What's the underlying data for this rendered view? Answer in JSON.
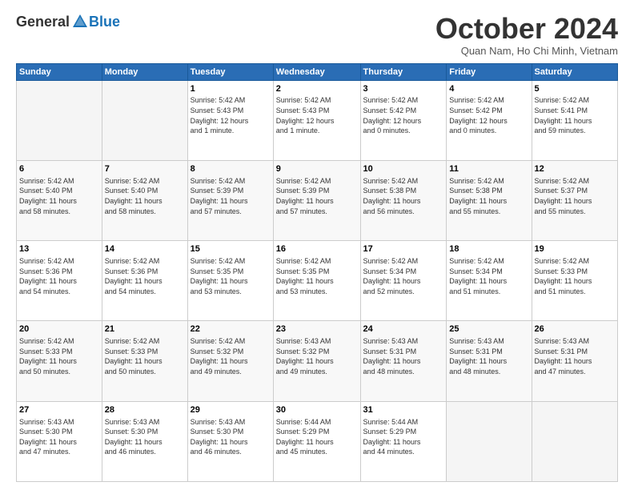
{
  "logo": {
    "general": "General",
    "blue": "Blue"
  },
  "header": {
    "title": "October 2024",
    "subtitle": "Quan Nam, Ho Chi Minh, Vietnam"
  },
  "days_of_week": [
    "Sunday",
    "Monday",
    "Tuesday",
    "Wednesday",
    "Thursday",
    "Friday",
    "Saturday"
  ],
  "weeks": [
    [
      {
        "day": "",
        "details": ""
      },
      {
        "day": "",
        "details": ""
      },
      {
        "day": "1",
        "details": "Sunrise: 5:42 AM\nSunset: 5:43 PM\nDaylight: 12 hours\nand 1 minute."
      },
      {
        "day": "2",
        "details": "Sunrise: 5:42 AM\nSunset: 5:43 PM\nDaylight: 12 hours\nand 1 minute."
      },
      {
        "day": "3",
        "details": "Sunrise: 5:42 AM\nSunset: 5:42 PM\nDaylight: 12 hours\nand 0 minutes."
      },
      {
        "day": "4",
        "details": "Sunrise: 5:42 AM\nSunset: 5:42 PM\nDaylight: 12 hours\nand 0 minutes."
      },
      {
        "day": "5",
        "details": "Sunrise: 5:42 AM\nSunset: 5:41 PM\nDaylight: 11 hours\nand 59 minutes."
      }
    ],
    [
      {
        "day": "6",
        "details": "Sunrise: 5:42 AM\nSunset: 5:40 PM\nDaylight: 11 hours\nand 58 minutes."
      },
      {
        "day": "7",
        "details": "Sunrise: 5:42 AM\nSunset: 5:40 PM\nDaylight: 11 hours\nand 58 minutes."
      },
      {
        "day": "8",
        "details": "Sunrise: 5:42 AM\nSunset: 5:39 PM\nDaylight: 11 hours\nand 57 minutes."
      },
      {
        "day": "9",
        "details": "Sunrise: 5:42 AM\nSunset: 5:39 PM\nDaylight: 11 hours\nand 57 minutes."
      },
      {
        "day": "10",
        "details": "Sunrise: 5:42 AM\nSunset: 5:38 PM\nDaylight: 11 hours\nand 56 minutes."
      },
      {
        "day": "11",
        "details": "Sunrise: 5:42 AM\nSunset: 5:38 PM\nDaylight: 11 hours\nand 55 minutes."
      },
      {
        "day": "12",
        "details": "Sunrise: 5:42 AM\nSunset: 5:37 PM\nDaylight: 11 hours\nand 55 minutes."
      }
    ],
    [
      {
        "day": "13",
        "details": "Sunrise: 5:42 AM\nSunset: 5:36 PM\nDaylight: 11 hours\nand 54 minutes."
      },
      {
        "day": "14",
        "details": "Sunrise: 5:42 AM\nSunset: 5:36 PM\nDaylight: 11 hours\nand 54 minutes."
      },
      {
        "day": "15",
        "details": "Sunrise: 5:42 AM\nSunset: 5:35 PM\nDaylight: 11 hours\nand 53 minutes."
      },
      {
        "day": "16",
        "details": "Sunrise: 5:42 AM\nSunset: 5:35 PM\nDaylight: 11 hours\nand 53 minutes."
      },
      {
        "day": "17",
        "details": "Sunrise: 5:42 AM\nSunset: 5:34 PM\nDaylight: 11 hours\nand 52 minutes."
      },
      {
        "day": "18",
        "details": "Sunrise: 5:42 AM\nSunset: 5:34 PM\nDaylight: 11 hours\nand 51 minutes."
      },
      {
        "day": "19",
        "details": "Sunrise: 5:42 AM\nSunset: 5:33 PM\nDaylight: 11 hours\nand 51 minutes."
      }
    ],
    [
      {
        "day": "20",
        "details": "Sunrise: 5:42 AM\nSunset: 5:33 PM\nDaylight: 11 hours\nand 50 minutes."
      },
      {
        "day": "21",
        "details": "Sunrise: 5:42 AM\nSunset: 5:33 PM\nDaylight: 11 hours\nand 50 minutes."
      },
      {
        "day": "22",
        "details": "Sunrise: 5:42 AM\nSunset: 5:32 PM\nDaylight: 11 hours\nand 49 minutes."
      },
      {
        "day": "23",
        "details": "Sunrise: 5:43 AM\nSunset: 5:32 PM\nDaylight: 11 hours\nand 49 minutes."
      },
      {
        "day": "24",
        "details": "Sunrise: 5:43 AM\nSunset: 5:31 PM\nDaylight: 11 hours\nand 48 minutes."
      },
      {
        "day": "25",
        "details": "Sunrise: 5:43 AM\nSunset: 5:31 PM\nDaylight: 11 hours\nand 48 minutes."
      },
      {
        "day": "26",
        "details": "Sunrise: 5:43 AM\nSunset: 5:31 PM\nDaylight: 11 hours\nand 47 minutes."
      }
    ],
    [
      {
        "day": "27",
        "details": "Sunrise: 5:43 AM\nSunset: 5:30 PM\nDaylight: 11 hours\nand 47 minutes."
      },
      {
        "day": "28",
        "details": "Sunrise: 5:43 AM\nSunset: 5:30 PM\nDaylight: 11 hours\nand 46 minutes."
      },
      {
        "day": "29",
        "details": "Sunrise: 5:43 AM\nSunset: 5:30 PM\nDaylight: 11 hours\nand 46 minutes."
      },
      {
        "day": "30",
        "details": "Sunrise: 5:44 AM\nSunset: 5:29 PM\nDaylight: 11 hours\nand 45 minutes."
      },
      {
        "day": "31",
        "details": "Sunrise: 5:44 AM\nSunset: 5:29 PM\nDaylight: 11 hours\nand 44 minutes."
      },
      {
        "day": "",
        "details": ""
      },
      {
        "day": "",
        "details": ""
      }
    ]
  ]
}
